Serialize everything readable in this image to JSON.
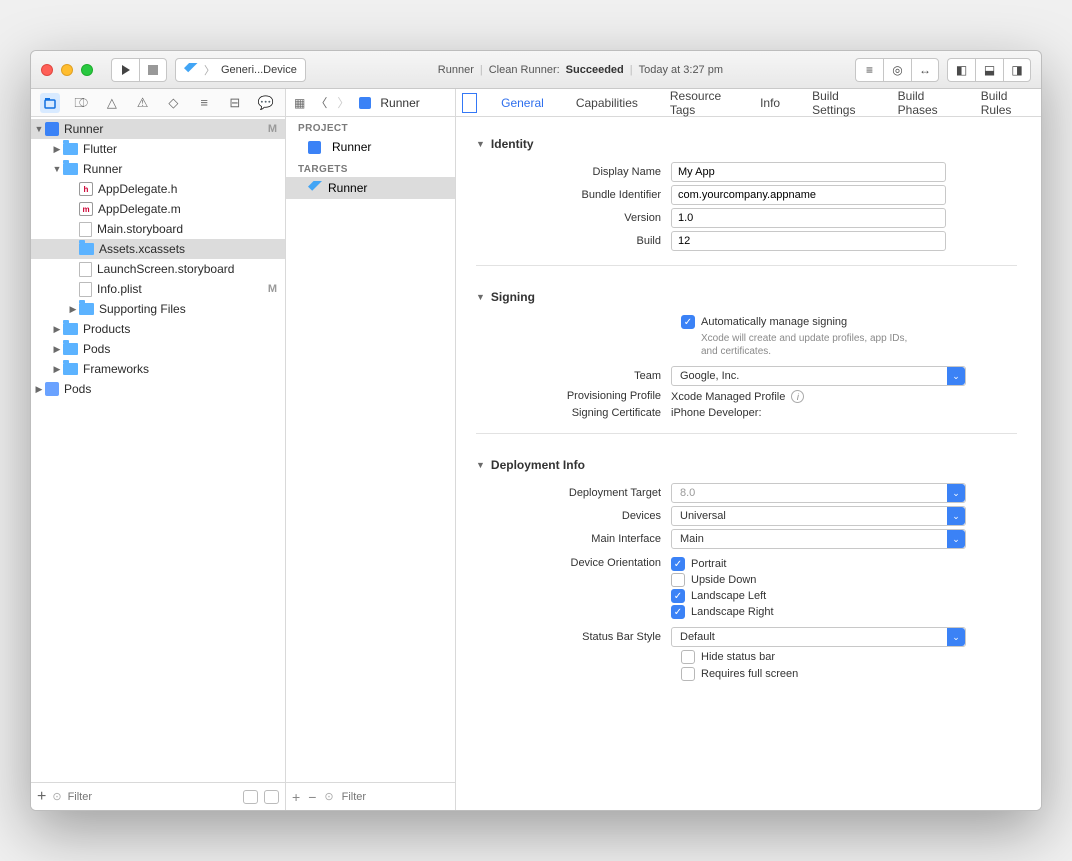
{
  "titlebar": {
    "scheme_left": "Generi...Device",
    "status_app": "Runner",
    "status_task": "Clean Runner:",
    "status_result": "Succeeded",
    "status_time": "Today at 3:27 pm"
  },
  "nav": {
    "root": "Runner",
    "root_badge": "M",
    "items": [
      {
        "label": "Flutter",
        "type": "folder",
        "indent": 1,
        "disc": "▶"
      },
      {
        "label": "Runner",
        "type": "folder",
        "indent": 1,
        "disc": "▼"
      },
      {
        "label": "AppDelegate.h",
        "type": "h",
        "indent": 2
      },
      {
        "label": "AppDelegate.m",
        "type": "m",
        "indent": 2
      },
      {
        "label": "Main.storyboard",
        "type": "file",
        "indent": 2
      },
      {
        "label": "Assets.xcassets",
        "type": "assets",
        "indent": 2,
        "sel": true
      },
      {
        "label": "LaunchScreen.storyboard",
        "type": "file",
        "indent": 2
      },
      {
        "label": "Info.plist",
        "type": "file",
        "indent": 2,
        "badge": "M"
      },
      {
        "label": "Supporting Files",
        "type": "folder",
        "indent": 2,
        "disc": "▶"
      },
      {
        "label": "Products",
        "type": "folder",
        "indent": 1,
        "disc": "▶"
      },
      {
        "label": "Pods",
        "type": "folder",
        "indent": 1,
        "disc": "▶"
      },
      {
        "label": "Frameworks",
        "type": "folder",
        "indent": 1,
        "disc": "▶"
      }
    ],
    "pods": "Pods",
    "filter_placeholder": "Filter"
  },
  "mid": {
    "crumb": "Runner",
    "sec_project": "PROJECT",
    "project_item": "Runner",
    "sec_targets": "TARGETS",
    "target_item": "Runner",
    "filter_placeholder": "Filter"
  },
  "tabs": [
    "General",
    "Capabilities",
    "Resource Tags",
    "Info",
    "Build Settings",
    "Build Phases",
    "Build Rules"
  ],
  "identity": {
    "header": "Identity",
    "display_name_label": "Display Name",
    "display_name": "My App",
    "bundle_label": "Bundle Identifier",
    "bundle": "com.yourcompany.appname",
    "version_label": "Version",
    "version": "1.0",
    "build_label": "Build",
    "build": "12"
  },
  "signing": {
    "header": "Signing",
    "auto_label": "Automatically manage signing",
    "auto_help": "Xcode will create and update profiles, app IDs, and certificates.",
    "team_label": "Team",
    "team": "Google, Inc.",
    "prov_label": "Provisioning Profile",
    "prov": "Xcode Managed Profile",
    "cert_label": "Signing Certificate",
    "cert": "iPhone Developer:"
  },
  "deploy": {
    "header": "Deployment Info",
    "target_label": "Deployment Target",
    "target": "8.0",
    "devices_label": "Devices",
    "devices": "Universal",
    "main_iface_label": "Main Interface",
    "main_iface": "Main",
    "orient_label": "Device Orientation",
    "orient": [
      {
        "label": "Portrait",
        "on": true
      },
      {
        "label": "Upside Down",
        "on": false
      },
      {
        "label": "Landscape Left",
        "on": true
      },
      {
        "label": "Landscape Right",
        "on": true
      }
    ],
    "status_label": "Status Bar Style",
    "status": "Default",
    "hide_status": "Hide status bar",
    "req_full": "Requires full screen"
  }
}
